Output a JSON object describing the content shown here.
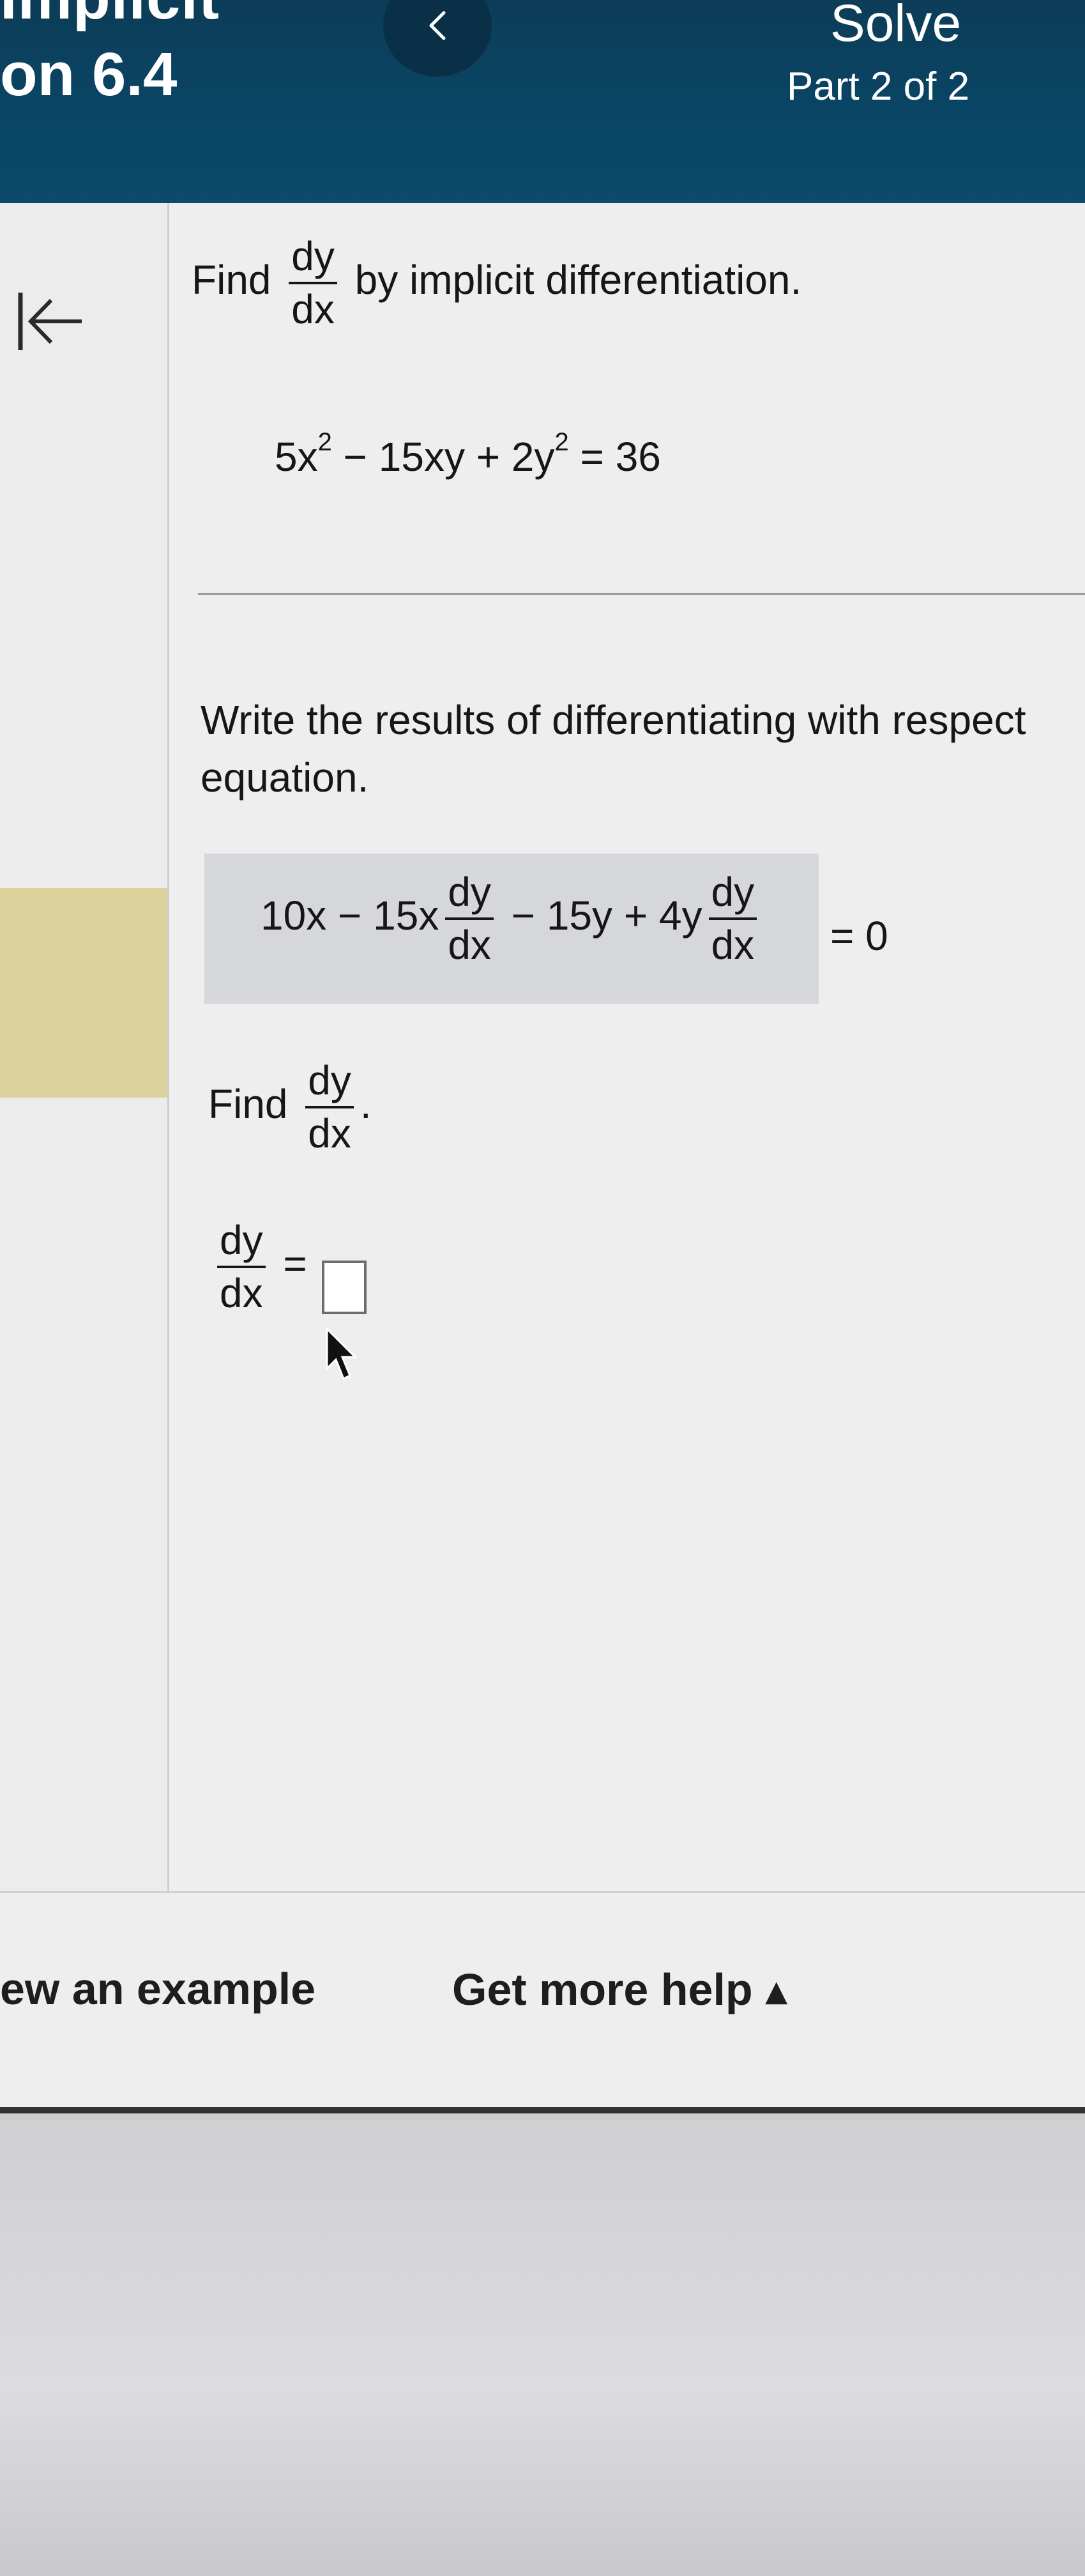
{
  "header": {
    "title_top": "Implicit",
    "title_bottom": "on 6.4",
    "back_label": "<",
    "solve_label": "Solve",
    "part_label": "Part 2 of 2",
    "bg_color": "#0b4a6b"
  },
  "question": {
    "find_prefix": "Find",
    "dy": "dy",
    "dx": "dx",
    "find_suffix": "by implicit differentiation.",
    "equation": {
      "t1": "5x",
      "e1": "2",
      "t2": " − 15xy + 2y",
      "e2": "2",
      "t3": " = 36"
    }
  },
  "step": {
    "instruction_line1": "Write the results of differentiating with respect",
    "instruction_line2": "equation.",
    "answer": {
      "a1": "10x − 15x",
      "a2": " − 15y + 4y",
      "a3": "= 0"
    },
    "find_label": "Find",
    "period": ".",
    "equals": "="
  },
  "footer": {
    "example_link": "ew an example",
    "help_link": "Get more help ▴"
  },
  "icons": {
    "collapse": "collapse-left-arrow-icon",
    "cursor": "mouse-pointer-icon"
  },
  "colors": {
    "header": "#0b4a6b",
    "highlight": "#ddd29c",
    "answer_shade": "#d6d7db"
  }
}
